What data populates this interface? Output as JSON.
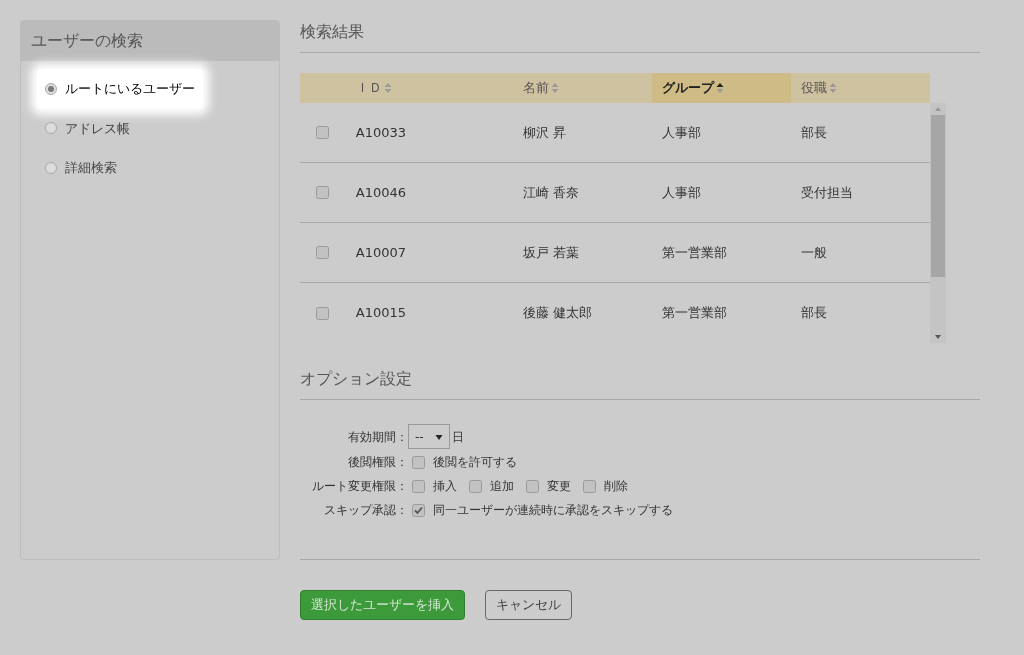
{
  "sidebar": {
    "title": "ユーザーの検索",
    "options": [
      {
        "label": "ルートにいるユーザー",
        "selected": true
      },
      {
        "label": "アドレス帳",
        "selected": false
      },
      {
        "label": "詳細検索",
        "selected": false
      }
    ]
  },
  "results": {
    "title": "検索結果",
    "table": {
      "columns": [
        {
          "label": "ＩＤ",
          "sorted": false
        },
        {
          "label": "名前",
          "sorted": false
        },
        {
          "label": "グループ",
          "sorted": true
        },
        {
          "label": "役職",
          "sorted": false
        }
      ],
      "rows": [
        {
          "checked": false,
          "cells": [
            "A10033",
            "柳沢 昇",
            "人事部",
            "部長"
          ]
        },
        {
          "checked": false,
          "cells": [
            "A10046",
            "江崎 香奈",
            "人事部",
            "受付担当"
          ]
        },
        {
          "checked": false,
          "cells": [
            "A10007",
            "坂戸 若葉",
            "第一営業部",
            "一般"
          ]
        },
        {
          "checked": false,
          "cells": [
            "A10015",
            "後藤 健太郎",
            "第一営業部",
            "部長"
          ]
        }
      ]
    }
  },
  "options": {
    "title": "オプション設定",
    "fields": [
      {
        "kind": "select",
        "label": "有効期間：",
        "value": "--",
        "suffix": "日"
      },
      {
        "kind": "checks",
        "label": "後閲権限：",
        "checks": [
          {
            "label": "後閲を許可する",
            "checked": false
          }
        ]
      },
      {
        "kind": "checks",
        "label": "ルート変更権限：",
        "checks": [
          {
            "label": "挿入",
            "checked": false
          },
          {
            "label": "追加",
            "checked": false
          },
          {
            "label": "変更",
            "checked": false
          },
          {
            "label": "削除",
            "checked": false
          }
        ]
      },
      {
        "kind": "checks",
        "label": "スキップ承認：",
        "checks": [
          {
            "label": "同一ユーザーが連続時に承認をスキップする",
            "checked": true
          }
        ]
      }
    ]
  },
  "buttons": {
    "primary": "選択したユーザーを挿入",
    "secondary": "キャンセル"
  }
}
